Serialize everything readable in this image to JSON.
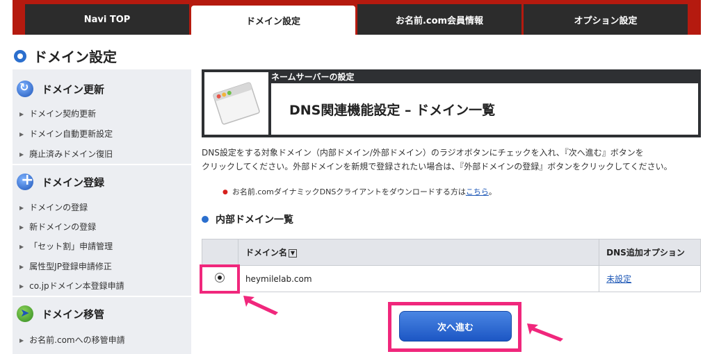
{
  "nav": {
    "tabs": [
      {
        "label": "Navi TOP"
      },
      {
        "label": "ドメイン設定"
      },
      {
        "label": "お名前.com会員情報"
      },
      {
        "label": "オプション設定"
      }
    ]
  },
  "page_title": "ドメイン設定",
  "sidebar": {
    "sections": [
      {
        "title": "ドメイン更新",
        "icon": "renew-icon",
        "items": [
          "ドメイン契約更新",
          "ドメイン自動更新設定",
          "廃止済みドメイン復旧"
        ]
      },
      {
        "title": "ドメイン登録",
        "icon": "plus-icon",
        "items": [
          "ドメインの登録",
          "新ドメインの登録",
          "「セット割」申請管理",
          "属性型JP登録申請修正",
          "co.jpドメイン本登録申請"
        ]
      },
      {
        "title": "ドメイン移管",
        "icon": "transfer-icon",
        "items": [
          "お名前.comへの移管申請"
        ]
      }
    ]
  },
  "header": {
    "subtitle": "ネームサーバーの設定",
    "title": "DNS関連機能設定 – ドメイン一覧"
  },
  "description": {
    "line1": "DNS設定をする対象ドメイン（内部ドメイン/外部ドメイン）のラジオボタンにチェックを入れ、『次へ進む』ボタンを",
    "line2": "クリックしてください。外部ドメインを新規で登録されたい場合は、『外部ドメインの登録』ボタンをクリックしてください。"
  },
  "note": {
    "text": "お名前.comダイナミックDNSクライアントをダウンロードする方は",
    "link": "こちら",
    "suffix": "。"
  },
  "section_title": "内部ドメイン一覧",
  "table": {
    "headers": {
      "domain": "ドメイン名",
      "dns_option": "DNS追加オプション"
    },
    "rows": [
      {
        "selected": true,
        "domain": "heymilelab.com",
        "dns_option": "未設定"
      }
    ]
  },
  "next_button": "次へ進む",
  "colors": {
    "nav_bar": "#b51a0f",
    "highlight": "#f0277c",
    "button": "#1c56c4",
    "accent": "#2b6fce"
  }
}
